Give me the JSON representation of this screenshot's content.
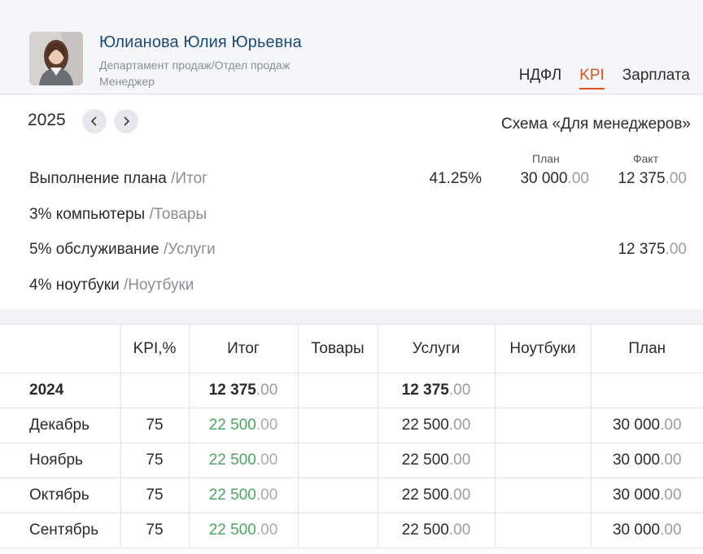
{
  "employee": {
    "name": "Юлианова Юлия Юрьевна",
    "department": "Департамент продаж/Отдел продаж",
    "position": "Менеджер"
  },
  "tabs": [
    {
      "label": "НДФЛ",
      "active": false
    },
    {
      "label": "KPI",
      "active": true
    },
    {
      "label": "Зарплата",
      "active": false
    }
  ],
  "year": "2025",
  "scheme": "Схема «Для менеджеров»",
  "summary": {
    "plan_header": "План",
    "fact_header": "Факт",
    "rows": [
      {
        "name": "Выполнение плана",
        "category": "/Итог",
        "pct": "41.25%",
        "plan_int": "30 000",
        "plan_dec": ".00",
        "fact_int": "12 375",
        "fact_dec": ".00"
      },
      {
        "name": "3% компьютеры",
        "category": "/Товары",
        "pct": "",
        "plan_int": "",
        "plan_dec": "",
        "fact_int": "",
        "fact_dec": ""
      },
      {
        "name": "5% обслуживание",
        "category": "/Услуги",
        "pct": "",
        "plan_int": "",
        "plan_dec": "",
        "fact_int": "12 375",
        "fact_dec": ".00"
      },
      {
        "name": "4% ноутбуки",
        "category": "/Ноутбуки",
        "pct": "",
        "plan_int": "",
        "plan_dec": "",
        "fact_int": "",
        "fact_dec": ""
      }
    ]
  },
  "table": {
    "headers": [
      "",
      "KPI,%",
      "Итог",
      "Товары",
      "Услуги",
      "Ноутбуки",
      "План"
    ],
    "year_row": {
      "label": "2024",
      "kpi": "",
      "total_int": "12 375",
      "total_dec": ".00",
      "goods": "",
      "services_int": "12 375",
      "services_dec": ".00",
      "laptops": "",
      "plan_int": "",
      "plan_dec": ""
    },
    "rows": [
      {
        "month": "Декабрь",
        "kpi": "75",
        "total_int": "22 500",
        "total_dec": ".00",
        "services_int": "22 500",
        "services_dec": ".00",
        "plan_int": "30 000",
        "plan_dec": ".00"
      },
      {
        "month": "Ноябрь",
        "kpi": "75",
        "total_int": "22 500",
        "total_dec": ".00",
        "services_int": "22 500",
        "services_dec": ".00",
        "plan_int": "30 000",
        "plan_dec": ".00"
      },
      {
        "month": "Октябрь",
        "kpi": "75",
        "total_int": "22 500",
        "total_dec": ".00",
        "services_int": "22 500",
        "services_dec": ".00",
        "plan_int": "30 000",
        "plan_dec": ".00"
      },
      {
        "month": "Сентябрь",
        "kpi": "75",
        "total_int": "22 500",
        "total_dec": ".00",
        "services_int": "22 500",
        "services_dec": ".00",
        "plan_int": "30 000",
        "plan_dec": ".00"
      }
    ]
  },
  "colors": {
    "accent": "#d9541e",
    "name": "#1d4a73",
    "positive": "#4aa564"
  }
}
